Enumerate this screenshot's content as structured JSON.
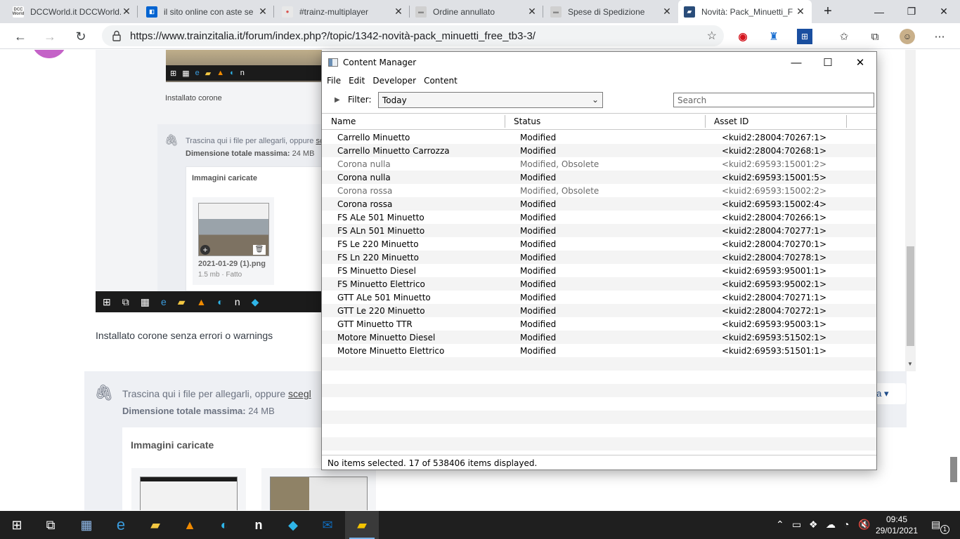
{
  "browser": {
    "tabs": [
      {
        "label": "DCCWorld.it DCCWorld.it se",
        "icon_text": "DCC World",
        "icon_color": "#ffffff"
      },
      {
        "label": "il sito online con aste se",
        "icon_text": "",
        "icon_color": "#0063d1"
      },
      {
        "label": "#trainz-multiplayer",
        "icon_text": "",
        "icon_color": "#e8e8e8"
      },
      {
        "label": "Ordine annullato",
        "icon_text": "",
        "icon_color": "#d0d0d0"
      },
      {
        "label": "Spese di Spedizione",
        "icon_text": "",
        "icon_color": "#d0d0d0"
      },
      {
        "label": "Novità: Pack_Minuetti_F",
        "icon_text": "",
        "icon_color": "#2a4d7a"
      }
    ],
    "active_tab_index": 5,
    "url": "https://www.trainzitalia.it/forum/index.php?/topic/1342-novità-pack_minuetti_free_tb3-3/",
    "icons": {
      "back": "back-arrow-icon",
      "forward": "forward-arrow-icon",
      "refresh": "refresh-icon",
      "new_tab": "plus-icon"
    }
  },
  "forum": {
    "caption_installed": "Installato corone",
    "drag_text_small": "Trascina qui i file per allegarli, oppure",
    "drag_link_small": "sc",
    "max_size_label_small": "Dimensione totale massima:",
    "max_size_value_small": "24 MB",
    "uploaded_images_small": "Immagini caricate",
    "file_name": "2021-01-29 (1).png",
    "file_meta": "1.5 mb · Fatto",
    "post_text": "Installato corone senza errori o warnings",
    "drag_text": "Trascina qui i file per allegarli, oppure",
    "drag_link": "scegl",
    "max_size_label": "Dimensione totale massima:",
    "max_size_value": "24 MB",
    "uploaded_images": "Immagini caricate",
    "media_button": "dia ▾"
  },
  "content_manager": {
    "title": "Content Manager",
    "menu": [
      "File",
      "Edit",
      "Developer",
      "Content"
    ],
    "filter_label": "Filter:",
    "filter_value": "Today",
    "search_placeholder": "Search",
    "columns": [
      "Name",
      "Status",
      "Asset ID"
    ],
    "rows": [
      {
        "name": "Carrello Minuetto",
        "status": "Modified",
        "asset_id": "<kuid2:28004:70267:1>",
        "obsolete": false
      },
      {
        "name": "Carrello Minuetto Carrozza",
        "status": "Modified",
        "asset_id": "<kuid2:28004:70268:1>",
        "obsolete": false
      },
      {
        "name": "Corona nulla",
        "status": "Modified, Obsolete",
        "asset_id": "<kuid2:69593:15001:2>",
        "obsolete": true
      },
      {
        "name": "Corona nulla",
        "status": "Modified",
        "asset_id": "<kuid2:69593:15001:5>",
        "obsolete": false
      },
      {
        "name": "Corona rossa",
        "status": "Modified, Obsolete",
        "asset_id": "<kuid2:69593:15002:2>",
        "obsolete": true
      },
      {
        "name": "Corona rossa",
        "status": "Modified",
        "asset_id": "<kuid2:69593:15002:4>",
        "obsolete": false
      },
      {
        "name": "FS ALe 501 Minuetto",
        "status": "Modified",
        "asset_id": "<kuid2:28004:70266:1>",
        "obsolete": false
      },
      {
        "name": "FS ALn 501 Minuetto",
        "status": "Modified",
        "asset_id": "<kuid2:28004:70277:1>",
        "obsolete": false
      },
      {
        "name": "FS Le 220 Minuetto",
        "status": "Modified",
        "asset_id": "<kuid2:28004:70270:1>",
        "obsolete": false
      },
      {
        "name": "FS Ln 220 Minuetto",
        "status": "Modified",
        "asset_id": "<kuid2:28004:70278:1>",
        "obsolete": false
      },
      {
        "name": "FS Minuetto Diesel",
        "status": "Modified",
        "asset_id": "<kuid2:69593:95001:1>",
        "obsolete": false
      },
      {
        "name": "FS Minuetto Elettrico",
        "status": "Modified",
        "asset_id": "<kuid2:69593:95002:1>",
        "obsolete": false
      },
      {
        "name": "GTT ALe 501 Minuetto",
        "status": "Modified",
        "asset_id": "<kuid2:28004:70271:1>",
        "obsolete": false
      },
      {
        "name": "GTT Le 220 Minuetto",
        "status": "Modified",
        "asset_id": "<kuid2:28004:70272:1>",
        "obsolete": false
      },
      {
        "name": "GTT Minuetto TTR",
        "status": "Modified",
        "asset_id": "<kuid2:69593:95003:1>",
        "obsolete": false
      },
      {
        "name": "Motore Minuetto Diesel",
        "status": "Modified",
        "asset_id": "<kuid2:69593:51502:1>",
        "obsolete": false
      },
      {
        "name": "Motore Minuetto Elettrico",
        "status": "Modified",
        "asset_id": "<kuid2:69593:51501:1>",
        "obsolete": false
      }
    ],
    "empty_rows": 7,
    "status_bar": "No items selected. 17 of 538406 items displayed."
  },
  "taskbar": {
    "time": "09:45",
    "date": "29/01/2021",
    "notification_count": "1",
    "apps": [
      "calculator-icon",
      "ie-icon",
      "file-explorer-icon",
      "vlc-icon",
      "edge-icon",
      "n-app-icon",
      "kodi-icon",
      "outlook-icon",
      "folder-app-icon"
    ]
  },
  "colors": {
    "accent_blue": "#1f4e8c",
    "taskbar_bg": "#1f1f1f",
    "tabstrip_bg": "#dfe1e5"
  }
}
